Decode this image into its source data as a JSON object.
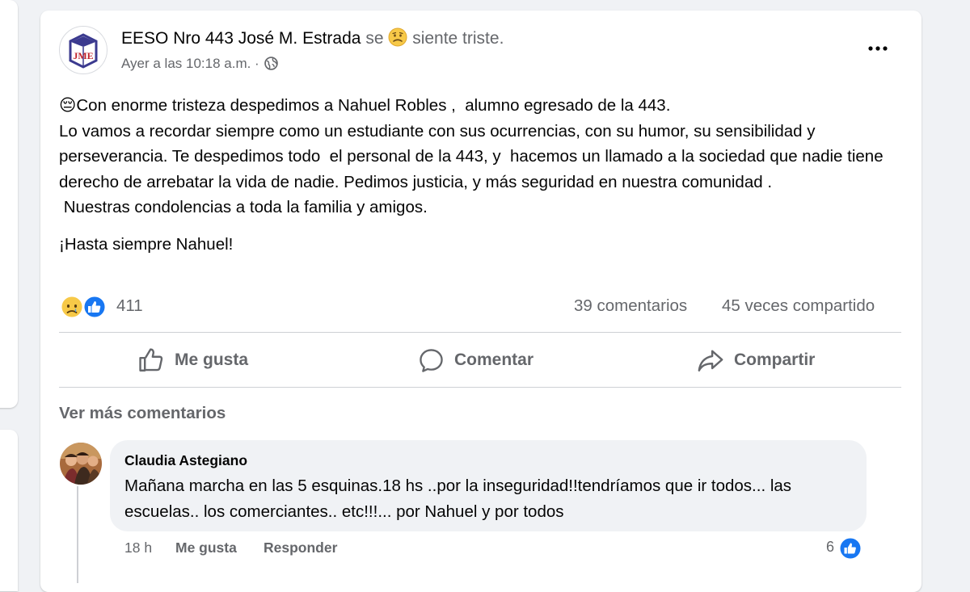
{
  "post": {
    "author": "EESO Nro 443 José M. Estrada",
    "feeling_prefix": "se",
    "feeling_text": "siente triste.",
    "timestamp": "Ayer a las 10:18 a.m. ·",
    "avatar_letters": "JME",
    "paragraph1": "😔Con enorme tristeza despedimos a Nahuel Robles ,  alumno egresado de la 443.\nLo vamos a recordar siempre como un estudiante con sus ocurrencias, con su humor, su sensibilidad y perseverancia. Te despedimos todo  el personal de la 443, y  hacemos un llamado a la sociedad que nadie tiene derecho de arrebatar la vida de nadie. Pedimos justicia, y más seguridad en nuestra comunidad .\n Nuestras condolencias a toda la familia y amigos.",
    "paragraph2": "¡Hasta siempre Nahuel!"
  },
  "stats": {
    "reactions": "411",
    "comments": "39 comentarios",
    "shares": "45 veces compartido"
  },
  "actions": {
    "like": "Me gusta",
    "comment": "Comentar",
    "share": "Compartir"
  },
  "comments_section": {
    "view_more": "Ver más comentarios",
    "comment": {
      "author": "Claudia Astegiano",
      "text": "Mañana marcha en las 5 esquinas.18 hs ..por la inseguridad!!tendríamos que ir todos... las escuelas.. los comerciantes.. etc!!!... por Nahuel y por todos",
      "time": "18 h",
      "like": "Me gusta",
      "reply": "Responder",
      "reaction_count": "6"
    }
  },
  "colors": {
    "accent": "#1877f2",
    "secondary_text": "#65676b",
    "background": "#f0f2f5",
    "logo_border": "#3b3a8f",
    "logo_letters": "#c0222b"
  },
  "icons": {
    "feeling": "sad-face-icon",
    "privacy": "globe-icon",
    "menu": "more-dots-icon",
    "reactions": [
      "sad-reaction-icon",
      "like-reaction-icon"
    ],
    "like": "thumbs-up-icon",
    "comment": "speech-bubble-icon",
    "share": "share-arrow-icon"
  }
}
